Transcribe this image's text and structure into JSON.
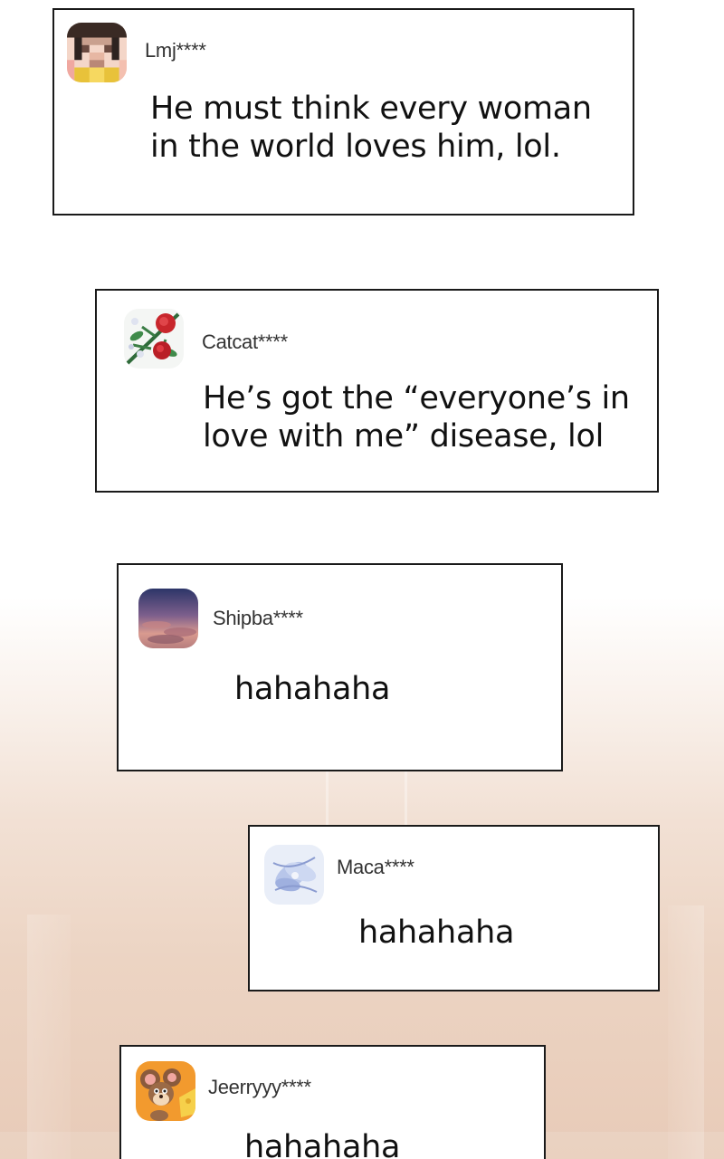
{
  "comments": [
    {
      "username": "Lmj****",
      "avatar_icon": "pixelated-person-avatar-icon",
      "lines": [
        "He must think every woman",
        "in the world loves him, lol."
      ]
    },
    {
      "username": "Catcat****",
      "avatar_icon": "red-flowers-avatar-icon",
      "lines": [
        "He’s got the “everyone’s in",
        "love with me” disease, lol"
      ]
    },
    {
      "username": "Shipba****",
      "avatar_icon": "sunset-sky-avatar-icon",
      "lines": [
        "hahahaha"
      ]
    },
    {
      "username": "Maca****",
      "avatar_icon": "blue-flower-avatar-icon",
      "lines": [
        "hahahaha"
      ]
    },
    {
      "username": "Jeerryyy****",
      "avatar_icon": "cartoon-mouse-avatar-icon",
      "lines": [
        "hahahaha"
      ]
    }
  ],
  "colors": {
    "border": "#1a1a1a",
    "text": "#111111",
    "username": "#333333",
    "background_bottom": "#e8cbb8"
  }
}
